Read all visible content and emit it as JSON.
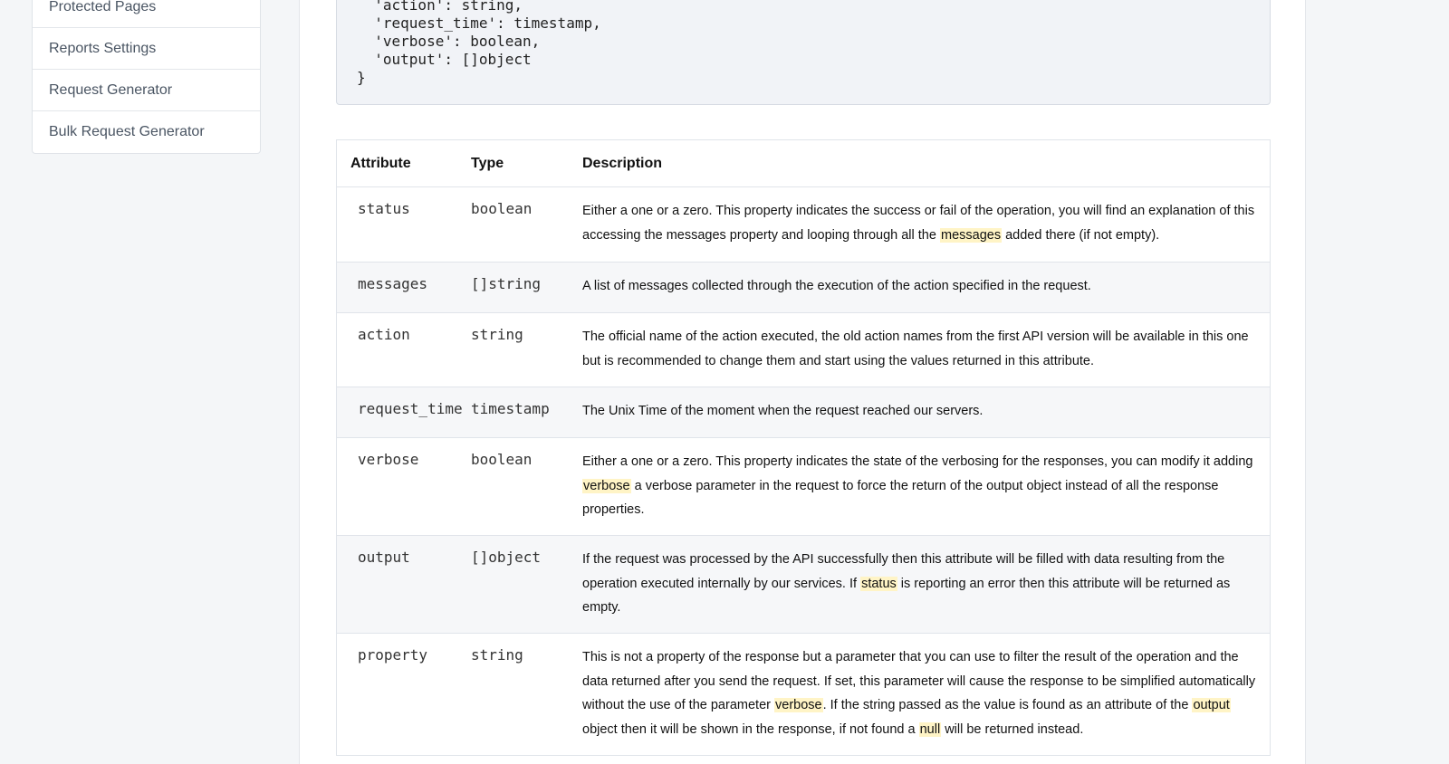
{
  "sidebar": {
    "items": [
      {
        "label": "Protected Pages"
      },
      {
        "label": "Reports Settings"
      },
      {
        "label": "Request Generator"
      },
      {
        "label": "Bulk Request Generator"
      }
    ]
  },
  "code": {
    "lines": [
      "  'action': string,",
      "  'request_time': timestamp,",
      "  'verbose': boolean,",
      "  'output': []object",
      "}"
    ]
  },
  "table": {
    "headers": {
      "attribute": "Attribute",
      "type": "Type",
      "description": "Description"
    },
    "rows": [
      {
        "attribute": "status",
        "type": "boolean",
        "desc": [
          {
            "t": "Either a one or a zero. This property indicates the success or fail of the operation, you will find an explanation of this accessing the messages property and looping through all the "
          },
          {
            "t": "messages",
            "hl": true
          },
          {
            "t": " added there (if not empty)."
          }
        ]
      },
      {
        "attribute": "messages",
        "type": "[]string",
        "desc": [
          {
            "t": "A list of messages collected through the execution of the action specified in the request."
          }
        ]
      },
      {
        "attribute": "action",
        "type": "string",
        "desc": [
          {
            "t": "The official name of the action executed, the old action names from the first API version will be available in this one but is recommended to change them and start using the values returned in this attribute."
          }
        ]
      },
      {
        "attribute": "request_time",
        "type": "timestamp",
        "desc": [
          {
            "t": "The Unix Time of the moment when the request reached our servers."
          }
        ]
      },
      {
        "attribute": "verbose",
        "type": "boolean",
        "desc": [
          {
            "t": "Either a one or a zero. This property indicates the state of the verbosing for the responses, you can modify it adding "
          },
          {
            "t": "verbose",
            "hl": true
          },
          {
            "t": " a verbose parameter in the request to force the return of the output object instead of all the response properties."
          }
        ]
      },
      {
        "attribute": "output",
        "type": "[]object",
        "desc": [
          {
            "t": "If the request was processed by the API successfully then this attribute will be filled with data resulting from the operation executed internally by our services. If "
          },
          {
            "t": "status",
            "hl": true
          },
          {
            "t": " is reporting an error then this attribute will be returned as empty."
          }
        ]
      },
      {
        "attribute": "property",
        "type": "string",
        "desc": [
          {
            "t": "This is not a property of the response but a parameter that you can use to filter the result of the operation and the data returned after you send the request. If set, this parameter will cause the response to be simplified automatically without the use of the parameter "
          },
          {
            "t": "verbose",
            "hl": true
          },
          {
            "t": ". If the string passed as the value is found as an attribute of the "
          },
          {
            "t": "output",
            "hl": true
          },
          {
            "t": " object then it will be shown in the response, if not found a "
          },
          {
            "t": "null",
            "hl": true
          },
          {
            "t": " will be returned instead."
          }
        ]
      }
    ]
  },
  "colors": {
    "highlight": "#fff4c6",
    "page_bg": "#f4f6f8",
    "code_bg": "#f1f3f7",
    "alt_row_bg": "#f6f7f9"
  }
}
